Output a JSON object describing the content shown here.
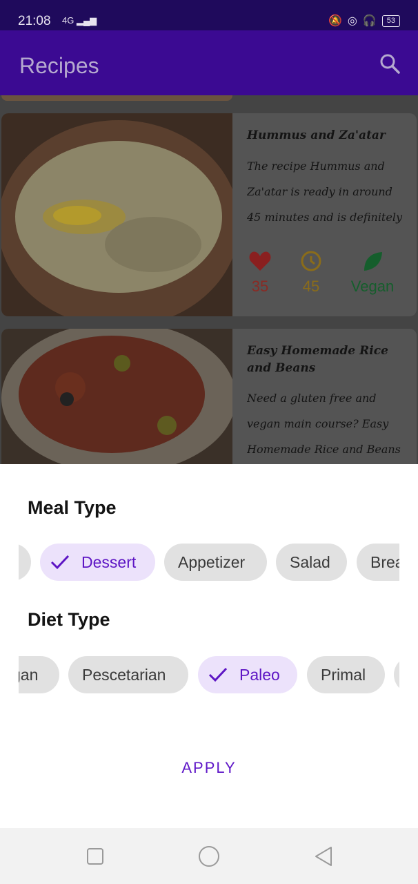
{
  "status_bar": {
    "time": "21:08",
    "network": "4G",
    "battery": "53"
  },
  "app_bar": {
    "title": "Recipes",
    "search_icon": "search-icon"
  },
  "recipes": [
    {
      "title": "Hummus and Za'atar",
      "description": "The recipe Hummus and Za'atar is ready in around 45 minutes and is definitely an outstanding...",
      "likes": "35",
      "minutes": "45",
      "diet_label": "Vegan",
      "icons": [
        "heart-icon",
        "clock-icon",
        "leaf-icon"
      ],
      "colors": {
        "likes": "#c42b2b",
        "minutes": "#c79a1c",
        "diet": "#1e7a3c"
      }
    },
    {
      "title": "Easy Homemade Rice and Beans",
      "description": "Need a gluten free and vegan main course? Easy Homemade Rice and Beans could be a great..."
    }
  ],
  "sheet": {
    "meal_type_title": "Meal Type",
    "meal_chips": [
      {
        "label": "",
        "selected": false
      },
      {
        "label": "Dessert",
        "selected": true
      },
      {
        "label": "Appetizer",
        "selected": false
      },
      {
        "label": "Salad",
        "selected": false
      },
      {
        "label": "Brea",
        "selected": false
      }
    ],
    "diet_type_title": "Diet Type",
    "diet_chips": [
      {
        "label": "gan",
        "selected": false
      },
      {
        "label": "Pescetarian",
        "selected": false
      },
      {
        "label": "Paleo",
        "selected": true
      },
      {
        "label": "Primal",
        "selected": false
      },
      {
        "label": "",
        "selected": false
      }
    ],
    "apply_label": "APPLY"
  },
  "nav_bar": {
    "buttons": [
      "recents-square-icon",
      "home-circle-icon",
      "back-triangle-icon"
    ]
  },
  "colors": {
    "primary": "#3b0a92",
    "accent": "#6019c8",
    "selected_chip_bg": "#ece2fb",
    "chip_bg": "#e1e1e1"
  }
}
